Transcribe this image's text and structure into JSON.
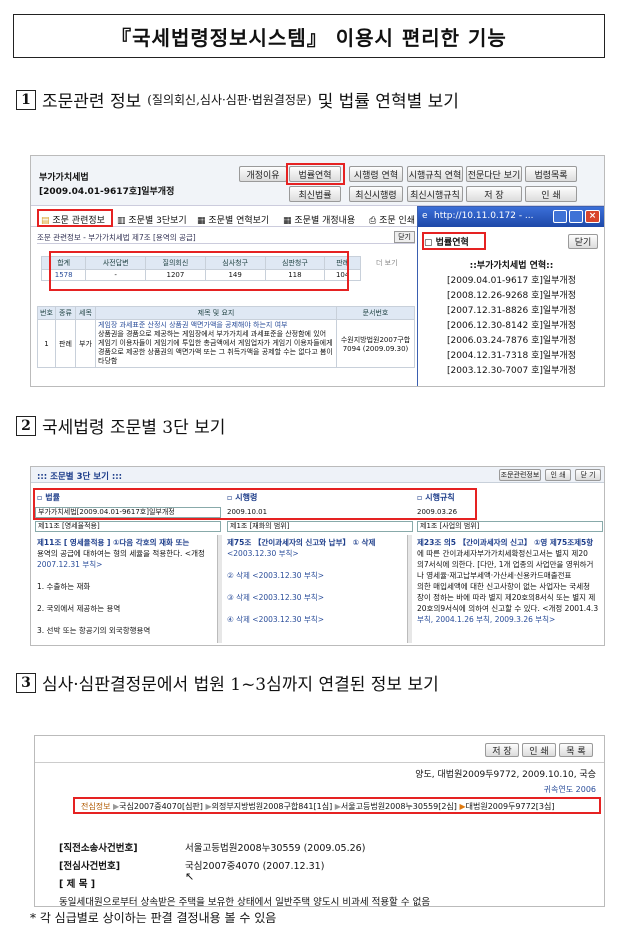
{
  "title": "『국세법령정보시스템』 이용시 편리한 기능",
  "sections": [
    {
      "num": "1",
      "head_main": "조문관련 정보",
      "head_paren": "(질의회신,심사·심판·법원결정문)",
      "head_tail": "및 법률 연혁별 보기"
    },
    {
      "num": "2",
      "head": "국세법령 조문별 3단 보기"
    },
    {
      "num": "3",
      "head": "심사·심판결정문에서 법원 1~3심까지 연결된 정보 보기"
    }
  ],
  "shot1": {
    "law_name": "부가가치세법",
    "law_rev": "[2009.04.01-9617호]일부개정",
    "buttons": [
      "개정이유",
      "법률연혁",
      "시행령 연혁",
      "시행규칙 연혁",
      "전문다단 보기",
      "법령목록",
      "최신법률",
      "최신시행령",
      "최신시행규칙",
      "저 장",
      "인 쇄"
    ],
    "tabs": [
      "조문 관련정보",
      "조문별 3단보기",
      "조문별 연혁보기",
      "조문별 개정내용",
      "조문 인쇄"
    ],
    "panel_title": "조문 관련정보 - 부가가치세법 제7조 [용역의 공급]",
    "close_label": "닫기",
    "more_label": "더 보기",
    "stats_headers": [
      "합계",
      "사전답변",
      "질의회신",
      "심사청구",
      "심판청구",
      "판례"
    ],
    "stats_values": [
      "1578",
      "-",
      "1207",
      "149",
      "118",
      "104"
    ],
    "list_headers": [
      "번호",
      "종류",
      "세목",
      "제목 및 요지",
      "문서번호"
    ],
    "row": {
      "no": "1",
      "kind": "판례",
      "tax": "부가",
      "summary_link": "게임장 과세표준 산정시 상품권 액면가액을 공제해야 하는지 여부",
      "summary": "상품권을 경품으로 제공하는 게임장에서 부가가치세 과세표준을 산정함에 있어 게임기 이용자들이 게임기에 투입한 총금액에서 게임업자가 게임기 이용자들에게 경품으로 제공한 상품권의 액면가액 또는 그 취득가액을 공제할 수는 없다고 봄이 타당함",
      "doc_no": "수원지방법원2007구합7094 (2009.09.30)"
    },
    "popup": {
      "url": "http://10.11.0.172 - ...",
      "tab": "법률연혁",
      "close_label": "닫기",
      "heading": "::부가가치세법 연혁::",
      "items": [
        "[2009.04.01-9617 호]일부개정",
        "[2008.12.26-9268 호]일부개정",
        "[2007.12.31-8826 호]일부개정",
        "[2006.12.30-8142 호]일부개정",
        "[2006.03.24-7876 호]일부개정",
        "[2004.12.31-7318 호]일부개정",
        "[2003.12.30-7007 호]일부개정"
      ]
    }
  },
  "shot2": {
    "title": "::: 조문별 3단 보기 :::",
    "top_buttons": [
      "조문관련정보",
      "인 쇄",
      "닫 기"
    ],
    "col_heads": [
      "법률",
      "시행령",
      "시행규칙"
    ],
    "col_revs": [
      "부가가치세법[2009.04.01-9617호]일부개정",
      "2009.10.01",
      "2009.03.26"
    ],
    "col_selects": [
      "제11조 [영세율적용]",
      "제1조 [재화의 범위]",
      "제1조 [사업의 범위]"
    ],
    "col1_lines": [
      "제11조 [ 영세율적용 ] ①다음 각호의 재화 또는",
      "용역의 공급에 대하여는 형의 세율을 적용한다. <개정",
      "2007.12.31 부칙>",
      "",
      "1. 수출하는 재화",
      "",
      "2. 국외에서 제공하는 용역",
      "",
      "3. 선박 또는 항공기의 외국항행용역"
    ],
    "col2_lines": [
      "제75조 【간이과세자의 신고와 납부】 ① 삭제",
      "<2003.12.30 부칙>",
      "",
      "② 삭제 <2003.12.30 부칙>",
      "",
      "③ 삭제 <2003.12.30 부칙>",
      "",
      "④ 삭제 <2003.12.30 부칙>"
    ],
    "col3_lines": [
      "제23조 의5 【간이과세자의 신고】 ①영 제75조제5항",
      "에 따른 간이과세자부가가치세확정신고서는 별지 제20",
      "의7서식에 의한다. [다만, 1개 업종의 사업만을 영위하거",
      "나 영세율·재고납부세액·가산세·신용카드매출전표",
      "의한 매입세액에 대한 신고사항이 없는 사업자는 국세청",
      "장이 정하는 바에 따라 별지 제20호의8서식 또는 별지 제",
      "20호의9서식에 의하여 신고할 수 있다. <개정 2001.4.3",
      "부칙, 2004.1.26 부칙, 2009.3.26 부칙>"
    ]
  },
  "shot3": {
    "buttons": [
      "저 장",
      "인 쇄",
      "목 록"
    ],
    "doc_line": "양도, 대법원2009두9772, 2009.10.10, 국승",
    "tag": "귀속연도 2006",
    "chain": [
      "전심정보",
      "국심2007중4070[심판]",
      "의정부지방법원2008구합841[1심]",
      "서울고등법원2008누30559[2심]",
      "대법원2009두9772[3심]"
    ],
    "fields": [
      {
        "label": "[직전소송사건번호]",
        "value": "서울고등법원2008누30559 (2009.05.26)"
      },
      {
        "label": "[전심사건번호]",
        "value": "국심2007중4070 (2007.12.31)"
      },
      {
        "label": "[ 제 목 ]",
        "value": ""
      }
    ],
    "summary": "동일세대원으로부터 상속받은 주택을 보유한 상태에서 일반주택 양도시 비과세 적용할 수 없음"
  },
  "footer_note": "* 각 심급별로 상이하는 판결 결정내용 볼 수 있음"
}
